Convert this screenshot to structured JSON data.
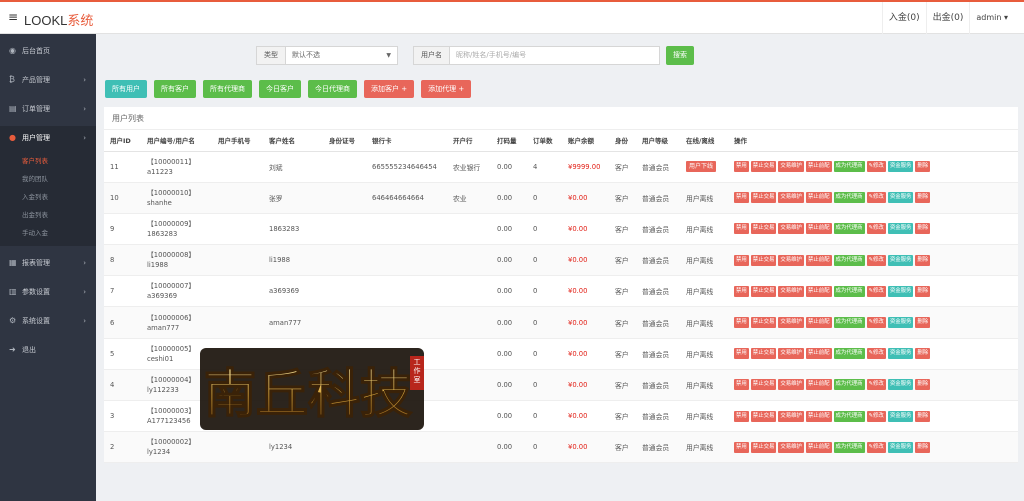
{
  "app": {
    "title_prefix": "LOOKL",
    "title_suffix": "系统",
    "accent": "#e85c3c"
  },
  "topbar": {
    "deposit": "入金(0)",
    "withdraw": "出金(0)",
    "user": "admin"
  },
  "sidebar": {
    "items": [
      {
        "label": "后台首页",
        "icon": "dashboard-icon",
        "arrow": false
      },
      {
        "label": "产品管理",
        "icon": "bitcoin-icon",
        "arrow": true
      },
      {
        "label": "订单管理",
        "icon": "order-icon",
        "arrow": true
      },
      {
        "label": "用户管理",
        "icon": "user-icon",
        "arrow": true,
        "active": true
      },
      {
        "label": "报表管理",
        "icon": "report-icon",
        "arrow": true
      },
      {
        "label": "参数设置",
        "icon": "parameter-icon",
        "arrow": true
      },
      {
        "label": "系统设置",
        "icon": "gear-icon",
        "arrow": true
      },
      {
        "label": "退出",
        "icon": "logout-icon",
        "arrow": false
      }
    ],
    "user_submenu": [
      "客户列表",
      "我的团队",
      "入金列表",
      "出金列表",
      "手动入金"
    ]
  },
  "filter": {
    "type_label": "类型",
    "type_value": "默认不选",
    "user_label": "用户名",
    "user_placeholder": "昵称/姓名/手机号/编号",
    "search_label": "搜索"
  },
  "actions": [
    {
      "label": "所有用户",
      "color": "teal"
    },
    {
      "label": "所有客户",
      "color": "green"
    },
    {
      "label": "所有代理商",
      "color": "green"
    },
    {
      "label": "今日客户",
      "color": "green"
    },
    {
      "label": "今日代理商",
      "color": "green"
    },
    {
      "label": "添加客户 +",
      "color": "red"
    },
    {
      "label": "添加代理 +",
      "color": "red"
    }
  ],
  "table": {
    "title": "用户列表",
    "columns": [
      "用户ID",
      "用户编号/用户名",
      "用户手机号",
      "客户姓名",
      "身份证号",
      "银行卡",
      "开户行",
      "打码量",
      "订单数",
      "账户余额",
      "身份",
      "用户等级",
      "在线/离线",
      "操作"
    ],
    "op_labels": [
      "禁用",
      "禁止交易",
      "交易维护",
      "禁止前配",
      "成为代理商",
      "✎修改",
      "资金服务",
      "删除"
    ],
    "rows": [
      {
        "id": "11",
        "no": "【10000011】",
        "username": "a11223",
        "phone": "",
        "name": "刘斌",
        "idcard": "",
        "bank_card": "665555234646454",
        "bank": "农业银行",
        "turnover": "0.00",
        "orders": "4",
        "balance": "¥9999.00",
        "role": "客户",
        "level": "普通会员",
        "online": "用户下线",
        "online_badge": true
      },
      {
        "id": "10",
        "no": "【10000010】",
        "username": "shanhe",
        "phone": "",
        "name": "张罗",
        "idcard": "",
        "bank_card": "646464664664",
        "bank": "农业",
        "turnover": "0.00",
        "orders": "0",
        "balance": "¥0.00",
        "role": "客户",
        "level": "普通会员",
        "online": "用户离线",
        "online_badge": false
      },
      {
        "id": "9",
        "no": "【10000009】",
        "username": "1863283",
        "phone": "",
        "name": "1863283",
        "idcard": "",
        "bank_card": "",
        "bank": "",
        "turnover": "0.00",
        "orders": "0",
        "balance": "¥0.00",
        "role": "客户",
        "level": "普通会员",
        "online": "用户离线",
        "online_badge": false
      },
      {
        "id": "8",
        "no": "【10000008】",
        "username": "li1988",
        "phone": "",
        "name": "li1988",
        "idcard": "",
        "bank_card": "",
        "bank": "",
        "turnover": "0.00",
        "orders": "0",
        "balance": "¥0.00",
        "role": "客户",
        "level": "普通会员",
        "online": "用户离线",
        "online_badge": false
      },
      {
        "id": "7",
        "no": "【10000007】",
        "username": "a369369",
        "phone": "",
        "name": "a369369",
        "idcard": "",
        "bank_card": "",
        "bank": "",
        "turnover": "0.00",
        "orders": "0",
        "balance": "¥0.00",
        "role": "客户",
        "level": "普通会员",
        "online": "用户离线",
        "online_badge": false
      },
      {
        "id": "6",
        "no": "【10000006】",
        "username": "aman777",
        "phone": "",
        "name": "aman777",
        "idcard": "",
        "bank_card": "",
        "bank": "",
        "turnover": "0.00",
        "orders": "0",
        "balance": "¥0.00",
        "role": "客户",
        "level": "普通会员",
        "online": "用户离线",
        "online_badge": false
      },
      {
        "id": "5",
        "no": "【10000005】",
        "username": "ceshi01",
        "phone": "",
        "name": "",
        "idcard": "",
        "bank_card": "",
        "bank": "",
        "turnover": "0.00",
        "orders": "0",
        "balance": "¥0.00",
        "role": "客户",
        "level": "普通会员",
        "online": "用户离线",
        "online_badge": false
      },
      {
        "id": "4",
        "no": "【10000004】",
        "username": "ly112233",
        "phone": "",
        "name": "",
        "idcard": "",
        "bank_card": "",
        "bank": "",
        "turnover": "0.00",
        "orders": "0",
        "balance": "¥0.00",
        "role": "客户",
        "level": "普通会员",
        "online": "用户离线",
        "online_badge": false
      },
      {
        "id": "3",
        "no": "【10000003】",
        "username": "A177123456",
        "phone": "",
        "name": "",
        "idcard": "",
        "bank_card": "",
        "bank": "",
        "turnover": "0.00",
        "orders": "0",
        "balance": "¥0.00",
        "role": "客户",
        "level": "普通会员",
        "online": "用户离线",
        "online_badge": false
      },
      {
        "id": "2",
        "no": "【10000002】",
        "username": "ly1234",
        "phone": "",
        "name": "ly1234",
        "idcard": "",
        "bank_card": "",
        "bank": "",
        "turnover": "0.00",
        "orders": "0",
        "balance": "¥0.00",
        "role": "客户",
        "level": "普通会员",
        "online": "用户离线",
        "online_badge": false
      }
    ]
  },
  "watermark": {
    "text": "南丘科技",
    "seal": "工作室"
  }
}
